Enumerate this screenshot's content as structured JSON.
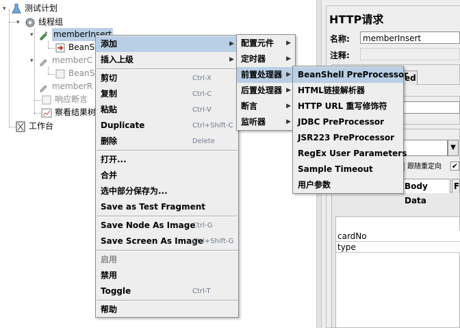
{
  "tree": {
    "items": [
      {
        "label": "测试计划"
      },
      {
        "label": "线程组"
      },
      {
        "label": "memberInsert"
      },
      {
        "label": "BeanS"
      },
      {
        "label": "memberC"
      },
      {
        "label": "BeanS"
      },
      {
        "label": "memberR"
      },
      {
        "label": "响应断言"
      },
      {
        "label": "察看结果树"
      },
      {
        "label": "工作台"
      }
    ]
  },
  "right_panel": {
    "title": "HTTP请求",
    "name_label": "名称:",
    "name_value": "memberInsert",
    "comment_label": "注释:",
    "tab_advanced_partial": "ed",
    "checkbox_partial_label": "跟随重定向",
    "tab_body_data": "Body Data",
    "tab_next_partial": "F",
    "params": [
      "cardNo",
      "type"
    ]
  },
  "context_menu": {
    "items": [
      {
        "label": "添加",
        "accel": "",
        "submenu": true
      },
      {
        "label": "插入上级",
        "accel": "",
        "submenu": true
      },
      {
        "label": "剪切",
        "accel": "Ctrl-X"
      },
      {
        "label": "复制",
        "accel": "Ctrl-C"
      },
      {
        "label": "粘贴",
        "accel": "Ctrl-V"
      },
      {
        "label": "Duplicate",
        "accel": "Ctrl+Shift-C"
      },
      {
        "label": "删除",
        "accel": "Delete"
      },
      {
        "label": "打开...",
        "accel": ""
      },
      {
        "label": "合并",
        "accel": ""
      },
      {
        "label": "选中部分保存为...",
        "accel": ""
      },
      {
        "label": "Save as Test Fragment",
        "accel": ""
      },
      {
        "label": "Save Node As Image",
        "accel": "Ctrl-G"
      },
      {
        "label": "Save Screen As Image",
        "accel": "Ctrl+Shift-G"
      },
      {
        "label": "启用",
        "accel": ""
      },
      {
        "label": "禁用",
        "accel": ""
      },
      {
        "label": "Toggle",
        "accel": "Ctrl-T"
      },
      {
        "label": "帮助",
        "accel": ""
      }
    ]
  },
  "add_submenu": {
    "items": [
      {
        "label": "配置元件"
      },
      {
        "label": "定时器"
      },
      {
        "label": "前置处理器"
      },
      {
        "label": "后置处理器"
      },
      {
        "label": "断言"
      },
      {
        "label": "监听器"
      }
    ]
  },
  "preprocessor_submenu": {
    "items": [
      {
        "label": "BeanShell PreProcessor"
      },
      {
        "label": "HTML链接解析器"
      },
      {
        "label": "HTTP URL 重写修饰符"
      },
      {
        "label": "JDBC PreProcessor"
      },
      {
        "label": "JSR223 PreProcessor"
      },
      {
        "label": "RegEx User Parameters"
      },
      {
        "label": "Sample Timeout"
      },
      {
        "label": "用户参数"
      }
    ]
  },
  "colors": {
    "highlight": "#b8cfe5",
    "menu_bg": "#eeeeee",
    "accelerator": "#6b7a8a",
    "disabled": "#8a8a8a"
  }
}
